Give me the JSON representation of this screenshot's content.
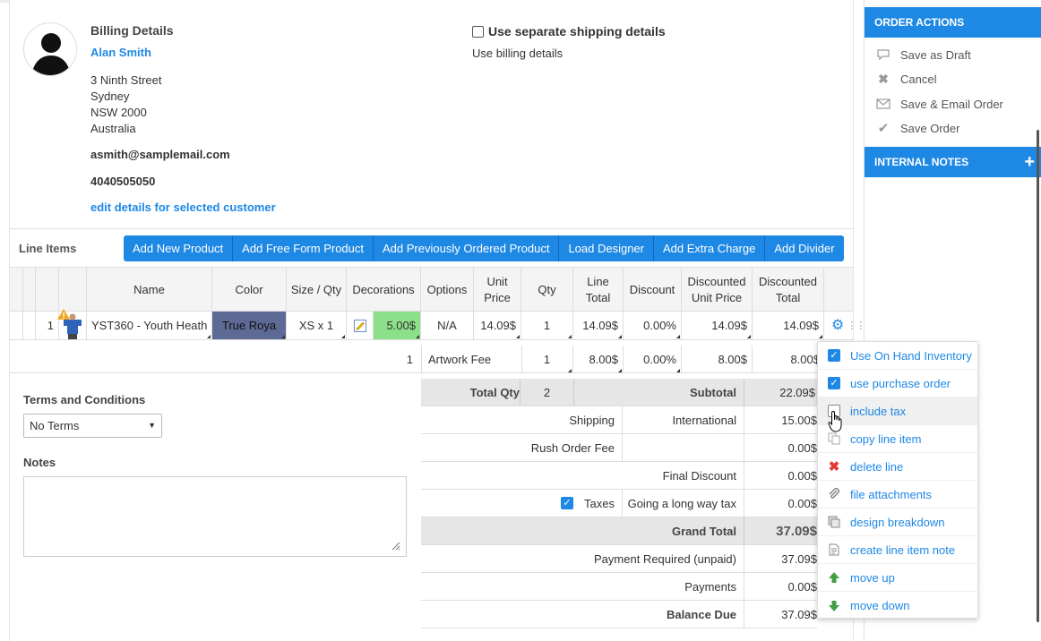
{
  "billing": {
    "heading": "Billing Details",
    "name": "Alan Smith",
    "address": [
      "3 Ninth Street",
      "Sydney",
      "NSW 2000",
      "Australia"
    ],
    "email": "asmith@samplemail.com",
    "phone": "4040505050",
    "edit_link": "edit details for selected customer"
  },
  "shipping": {
    "checkbox_label": "Use separate shipping details",
    "checked": false,
    "note": "Use billing details"
  },
  "line_items": {
    "label": "Line Items",
    "buttons": [
      "Add New Product",
      "Add Free Form Product",
      "Add Previously Ordered Product",
      "Load Designer",
      "Add Extra Charge",
      "Add Divider"
    ],
    "columns": {
      "name": "Name",
      "color": "Color",
      "size_qty": "Size / Qty",
      "decorations": "Decorations",
      "options": "Options",
      "unit_price": "Unit Price",
      "qty": "Qty",
      "line_total": "Line Total",
      "discount": "Discount",
      "disc_unit_price": "Discounted Unit Price",
      "disc_total": "Discounted Total"
    },
    "row": {
      "index": "1",
      "name": "YST360 - Youth Heath",
      "color": "True Roya",
      "size_qty": "XS x 1",
      "deco_price": "5.00$",
      "options": "N/A",
      "unit_price": "14.09$",
      "qty": "1",
      "line_total": "14.09$",
      "discount": "0.00%",
      "disc_unit_price": "14.09$",
      "disc_total": "14.09$"
    },
    "artwork": {
      "num": "1",
      "label": "Artwork Fee",
      "qty": "1",
      "price": "8.00$",
      "discount": "0.00%",
      "disc_unit": "8.00$",
      "disc_total": "8.00$"
    }
  },
  "summary": {
    "total_qty_label": "Total Qty",
    "total_qty": "2",
    "subtotal_label": "Subtotal",
    "subtotal": "22.09$",
    "shipping_label": "Shipping",
    "shipping_method": "International",
    "shipping": "15.00$",
    "rush_label": "Rush Order Fee",
    "rush": "0.00$",
    "final_discount_label": "Final Discount",
    "final_discount": "0.00$",
    "taxes_label": "Taxes",
    "tax_name": "Going a long way tax",
    "taxes": "0.00$",
    "grand_total_label": "Grand Total",
    "grand_total": "37.09$",
    "payment_required_label": "Payment Required (unpaid)",
    "payment_required": "37.09$",
    "payments_label": "Payments",
    "payments": "0.00$",
    "balance_due_label": "Balance Due",
    "balance_due": "37.09$"
  },
  "terms": {
    "label": "Terms and Conditions",
    "selected": "No Terms"
  },
  "notes": {
    "label": "Notes"
  },
  "order_actions": {
    "title": "ORDER ACTIONS",
    "items": [
      "Save as Draft",
      "Cancel",
      "Save & Email Order",
      "Save Order"
    ]
  },
  "internal_notes": {
    "title": "INTERNAL NOTES"
  },
  "context_menu": {
    "items": [
      "Use On Hand Inventory",
      "use purchase order",
      "include tax",
      "copy line item",
      "delete line",
      "file attachments",
      "design breakdown",
      "create line item note",
      "move up",
      "move down"
    ]
  },
  "colors": {
    "accent": "#1e88e5",
    "color_swatch": "#5d6a96",
    "deco_green": "#8de08a"
  }
}
